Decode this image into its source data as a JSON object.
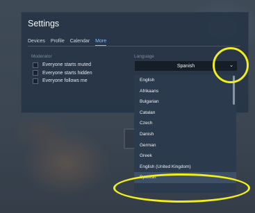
{
  "settings": {
    "title": "Settings",
    "tabs": [
      "Devices",
      "Profile",
      "Calendar",
      "More"
    ],
    "active_tab": "More",
    "moderator": {
      "label": "Moderator",
      "options": [
        "Everyone starts muted",
        "Everyone starts hidden",
        "Everyone follows me"
      ]
    },
    "language": {
      "label": "Language",
      "selected": "Spanish",
      "options": [
        "English",
        "Afrikaans",
        "Bulgarian",
        "Catalan",
        "Czech",
        "Danish",
        "German",
        "Greek",
        "English (United Kingdom)",
        "Spanish"
      ]
    }
  },
  "colors": {
    "highlight_circle": "#f2ee18",
    "active_tab": "#7fc0ff"
  }
}
